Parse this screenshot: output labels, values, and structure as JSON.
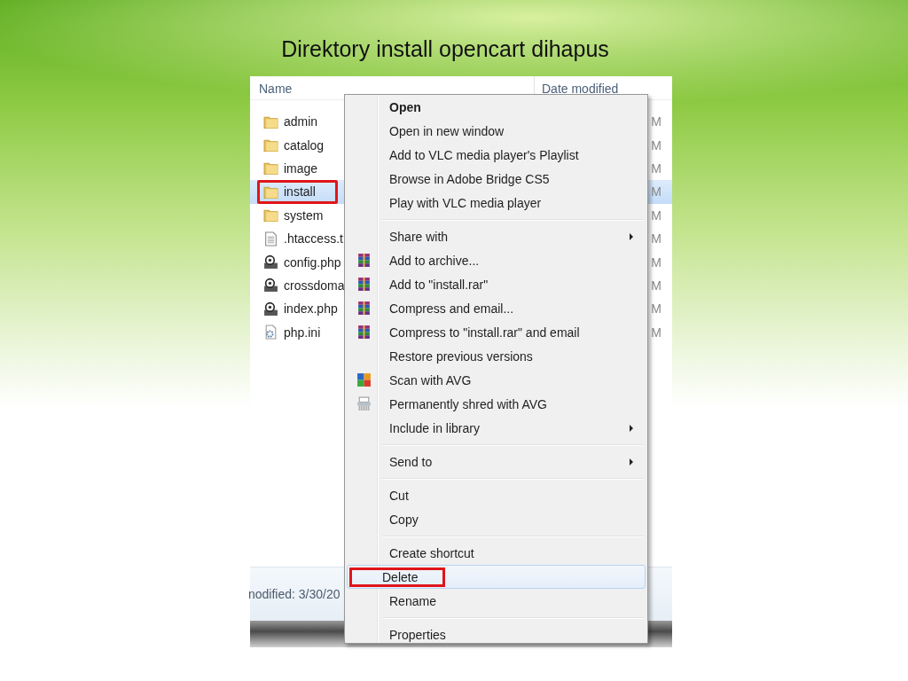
{
  "slide": {
    "title": "Direktory install opencart dihapus"
  },
  "explorer": {
    "columns": [
      "Name",
      "Date modified"
    ],
    "files": [
      {
        "name": "admin",
        "kind": "folder",
        "date_modified": "M",
        "selected": false,
        "annotated": false
      },
      {
        "name": "catalog",
        "kind": "folder",
        "date_modified": "M",
        "selected": false,
        "annotated": false
      },
      {
        "name": "image",
        "kind": "folder",
        "date_modified": "M",
        "selected": false,
        "annotated": false
      },
      {
        "name": "install",
        "kind": "folder",
        "date_modified": "M",
        "selected": true,
        "annotated": true
      },
      {
        "name": "system",
        "kind": "folder",
        "date_modified": "M",
        "selected": false,
        "annotated": false
      },
      {
        "name": ".htaccess.t",
        "kind": "text",
        "date_modified": "M",
        "selected": false,
        "annotated": false
      },
      {
        "name": "config.php",
        "kind": "script",
        "date_modified": "M",
        "selected": false,
        "annotated": false
      },
      {
        "name": "crossdoma",
        "kind": "script",
        "date_modified": "M",
        "selected": false,
        "annotated": false
      },
      {
        "name": "index.php",
        "kind": "script",
        "date_modified": "M",
        "selected": false,
        "annotated": false
      },
      {
        "name": "php.ini",
        "kind": "settings",
        "date_modified": "M",
        "selected": false,
        "annotated": false
      }
    ],
    "status_bar": {
      "text": "nodified: 3/30/20"
    }
  },
  "context_menu": {
    "groups": [
      {
        "items": [
          {
            "label": "Open",
            "default": true,
            "submenu": false,
            "highlighted": false,
            "annotated": false
          },
          {
            "label": "Open in new window",
            "submenu": false,
            "highlighted": false,
            "annotated": false
          },
          {
            "label": "Add to VLC media player's Playlist",
            "submenu": false,
            "highlighted": false,
            "annotated": false
          },
          {
            "label": "Browse in Adobe Bridge CS5",
            "submenu": false,
            "highlighted": false,
            "annotated": false
          },
          {
            "label": "Play with VLC media player",
            "submenu": false,
            "highlighted": false,
            "annotated": false
          }
        ]
      },
      {
        "items": [
          {
            "label": "Share with",
            "submenu": true,
            "highlighted": false,
            "annotated": false
          },
          {
            "label": "Add to archive...",
            "kind": "archive",
            "submenu": false,
            "highlighted": false,
            "annotated": false
          },
          {
            "label": "Add to \"install.rar\"",
            "kind": "archive",
            "submenu": false,
            "highlighted": false,
            "annotated": false
          },
          {
            "label": "Compress and email...",
            "kind": "archive",
            "submenu": false,
            "highlighted": false,
            "annotated": false
          },
          {
            "label": "Compress to \"install.rar\" and email",
            "kind": "archive",
            "submenu": false,
            "highlighted": false,
            "annotated": false
          },
          {
            "label": "Restore previous versions",
            "submenu": false,
            "highlighted": false,
            "annotated": false
          },
          {
            "label": "Scan with AVG",
            "kind": "scanner",
            "submenu": false,
            "highlighted": false,
            "annotated": false
          },
          {
            "label": "Permanently shred with AVG",
            "kind": "shredder",
            "submenu": false,
            "highlighted": false,
            "annotated": false
          },
          {
            "label": "Include in library",
            "submenu": true,
            "highlighted": false,
            "annotated": false
          }
        ]
      },
      {
        "items": [
          {
            "label": "Send to",
            "submenu": true,
            "highlighted": false,
            "annotated": false
          }
        ]
      },
      {
        "items": [
          {
            "label": "Cut",
            "submenu": false,
            "highlighted": false,
            "annotated": false
          },
          {
            "label": "Copy",
            "submenu": false,
            "highlighted": false,
            "annotated": false
          }
        ]
      },
      {
        "items": [
          {
            "label": "Create shortcut",
            "submenu": false,
            "highlighted": false,
            "annotated": false
          },
          {
            "label": "Delete",
            "submenu": false,
            "highlighted": true,
            "annotated": true
          },
          {
            "label": "Rename",
            "submenu": false,
            "highlighted": false,
            "annotated": false
          }
        ]
      },
      {
        "items": [
          {
            "label": "Properties",
            "submenu": false,
            "highlighted": false,
            "annotated": false
          }
        ]
      }
    ]
  }
}
